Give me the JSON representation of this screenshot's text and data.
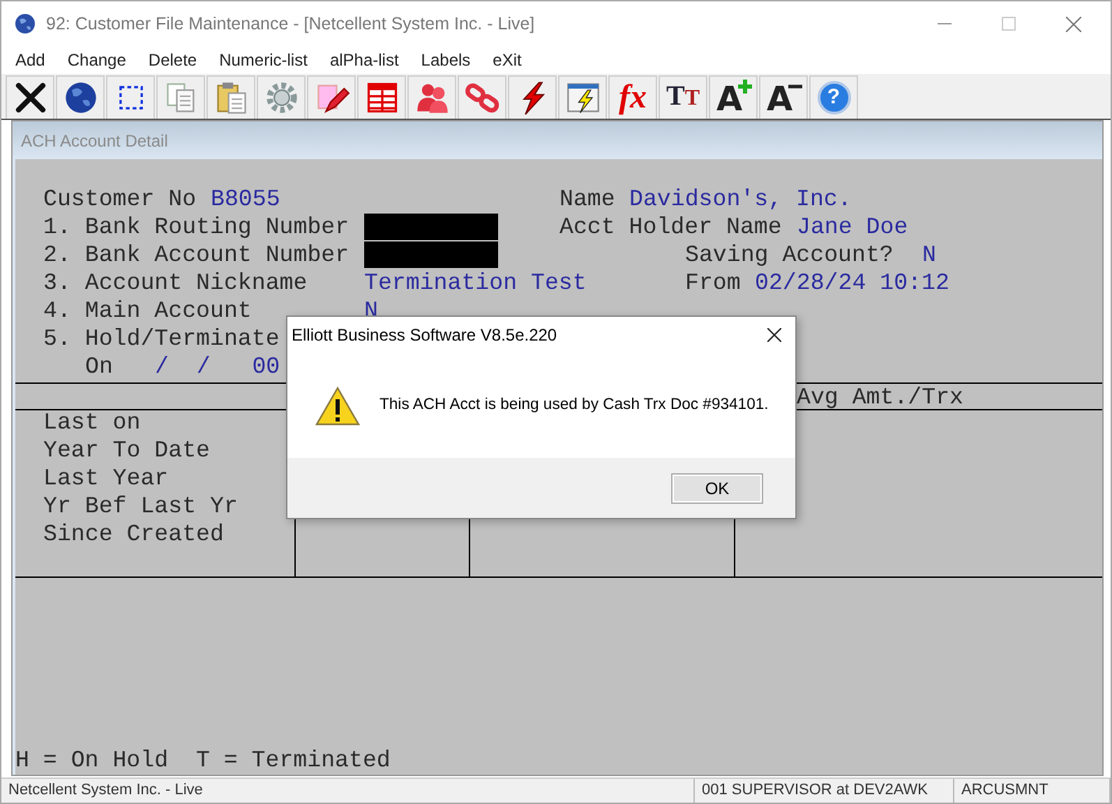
{
  "window": {
    "title": "92: Customer File Maintenance - [Netcellent System Inc. - Live]"
  },
  "menu": [
    "Add",
    "Change",
    "Delete",
    "Numeric-list",
    "alPha-list",
    "Labels",
    "eXit"
  ],
  "toolbar": [
    {
      "kind": "cross"
    },
    {
      "kind": "globe"
    },
    {
      "kind": "selection"
    },
    {
      "kind": "copy"
    },
    {
      "kind": "clipboard"
    },
    {
      "kind": "gear"
    },
    {
      "kind": "pencil"
    },
    {
      "kind": "table"
    },
    {
      "kind": "people"
    },
    {
      "kind": "chain"
    },
    {
      "kind": "lightning"
    },
    {
      "kind": "window-lightning"
    },
    {
      "kind": "text",
      "text": "fx"
    },
    {
      "kind": "text",
      "text": "TT"
    },
    {
      "kind": "font-up",
      "text": "A"
    },
    {
      "kind": "font-down",
      "text": "A"
    },
    {
      "kind": "help",
      "text": "?"
    }
  ],
  "child_window": {
    "title": "ACH Account Detail"
  },
  "fields": [
    {
      "label": "Customer No",
      "value": "B8055"
    },
    {
      "label": "Name",
      "value": "Davidson's, Inc."
    },
    {
      "label": "1. Bank Routing Number",
      "redacted": true
    },
    {
      "label": "Acct Holder Name",
      "value": "Jane Doe"
    },
    {
      "label": "2. Bank Account Number",
      "redacted": true
    },
    {
      "label": "Saving Account?",
      "value": "N"
    },
    {
      "label": "3. Account Nickname",
      "value": "Termination Test"
    },
    {
      "label": "From",
      "value": "02/28/24 10:12"
    },
    {
      "label": "4. Main Account",
      "value": "N"
    },
    {
      "label": "5. Hold/Terminate"
    },
    {
      "label": "On",
      "value": "/  /   00"
    }
  ],
  "stats": {
    "columns": [
      "Avg Amt./Trx"
    ],
    "rows": [
      "Last on",
      "Year To Date",
      "Last Year",
      "Yr Bef Last Yr",
      "Since Created"
    ]
  },
  "legend": "H = On Hold  T = Terminated",
  "status_bar": [
    "Netcellent System Inc. - Live",
    "001 SUPERVISOR at DEV2AWK",
    "ARCUSMNT"
  ],
  "dialog": {
    "title": "Elliott Business Software V8.5e.220",
    "message": "This ACH Acct is being used by Cash Trx Doc #934101.",
    "buttons": [
      "OK"
    ]
  }
}
